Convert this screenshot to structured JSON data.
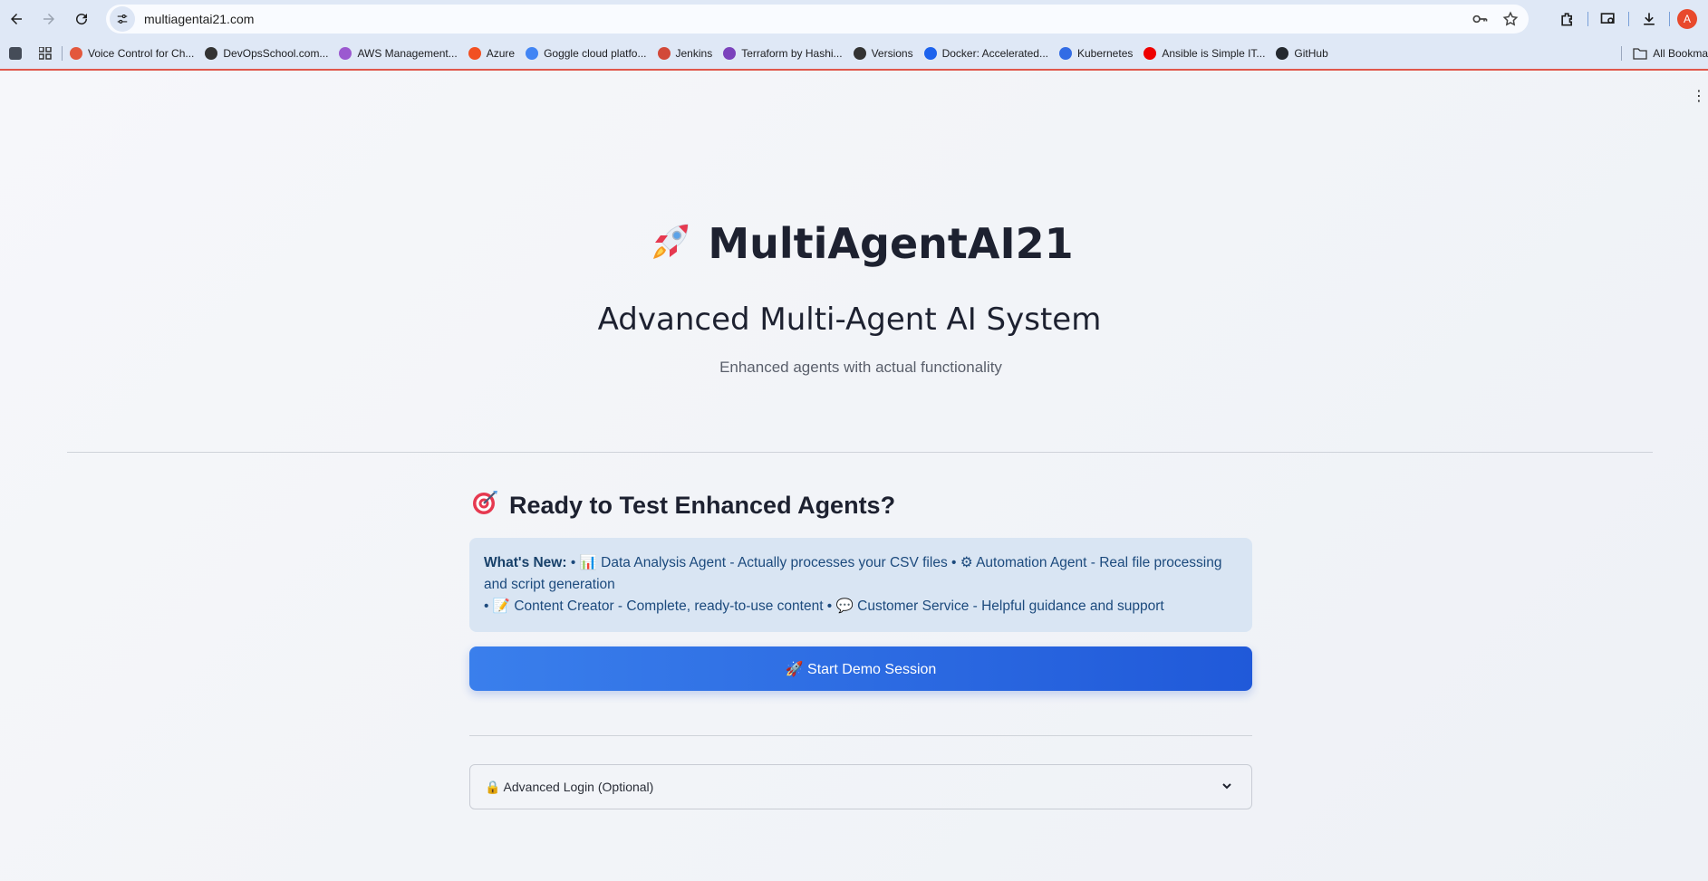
{
  "browser": {
    "url": "multiagentai21.com",
    "avatar_letter": "A",
    "bookmarks": [
      {
        "label": "Voice Control for Ch...",
        "color": "#e3583d"
      },
      {
        "label": "DevOpsSchool.com...",
        "color": "#333333"
      },
      {
        "label": "AWS Management...",
        "color": "#9b59d0"
      },
      {
        "label": "Azure",
        "color": "#f25022"
      },
      {
        "label": "Goggle cloud platfo...",
        "color": "#4285f4"
      },
      {
        "label": "Jenkins",
        "color": "#d24939"
      },
      {
        "label": "Terraform by Hashi...",
        "color": "#7b42bc"
      },
      {
        "label": "Versions",
        "color": "#333333"
      },
      {
        "label": "Docker: Accelerated...",
        "color": "#1d63ed"
      },
      {
        "label": "Kubernetes",
        "color": "#326ce5"
      },
      {
        "label": "Ansible is Simple IT...",
        "color": "#ee0000"
      },
      {
        "label": "GitHub",
        "color": "#24292f"
      }
    ],
    "all_bookmarks_label": "All Bookma"
  },
  "hero": {
    "title": "MultiAgentAI21",
    "subtitle": "Advanced Multi-Agent AI System",
    "tagline": "Enhanced agents with actual functionality"
  },
  "ready": {
    "heading": "Ready to Test Enhanced Agents?"
  },
  "whats_new": {
    "label": "What's New:",
    "line1": "• 📊 Data Analysis Agent - Actually processes your CSV files • ⚙ Automation Agent - Real file processing and script generation",
    "line2": "• 📝 Content Creator - Complete, ready-to-use content • 💬 Customer Service - Helpful guidance and support"
  },
  "demo_button": {
    "label": "🚀 Start Demo Session"
  },
  "login": {
    "label": "🔒 Advanced Login (Optional)"
  },
  "colors": {
    "primary_button_start": "#3a7fec",
    "primary_button_end": "#2059d9",
    "info_bg": "#d9e5f3",
    "info_text": "#1c4a7d"
  }
}
